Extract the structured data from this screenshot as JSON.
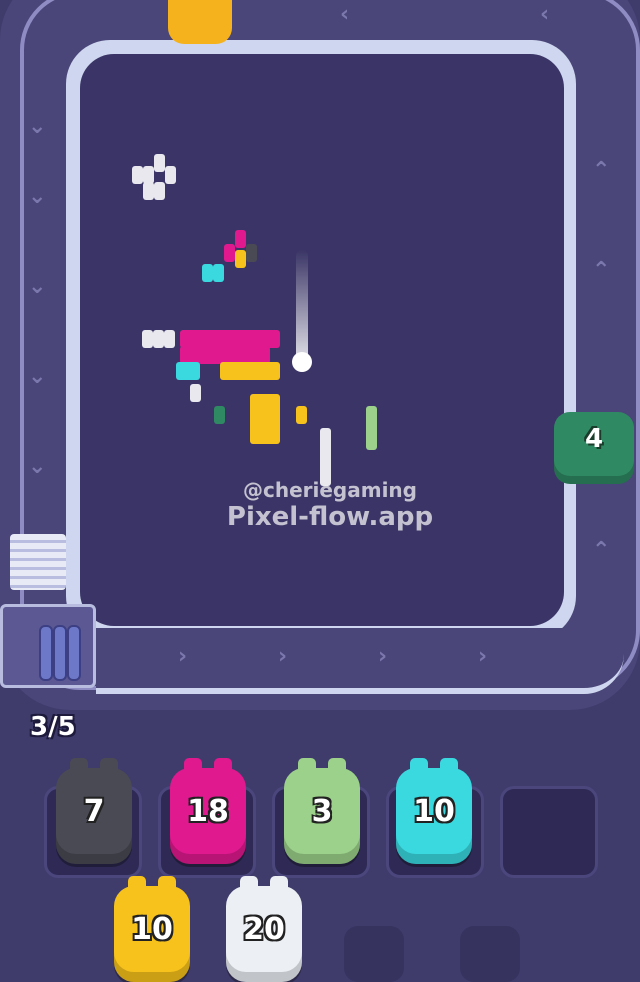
{
  "watermark": {
    "handle": "@cheriegaming",
    "site": "Pixel-flow.app"
  },
  "conveyor": {
    "green_pig_count": "4",
    "green_pig_color": "#2f8a63"
  },
  "queue": {
    "counter": "3/5"
  },
  "slots": [
    {
      "count": "7",
      "color": "#4a4a55"
    },
    {
      "count": "18",
      "color": "#e0198f"
    },
    {
      "count": "3",
      "color": "#9bd18a"
    },
    {
      "count": "10",
      "color": "#3ad9e0"
    },
    {
      "count": "",
      "color": "empty"
    }
  ],
  "waiting": [
    {
      "count": "10",
      "color": "#f7c21c"
    },
    {
      "count": "20",
      "color": "#eceff4"
    }
  ],
  "colors": {
    "background": "#3f3b6b",
    "board": "#3a3566",
    "board_border": "#cfd6ef"
  }
}
